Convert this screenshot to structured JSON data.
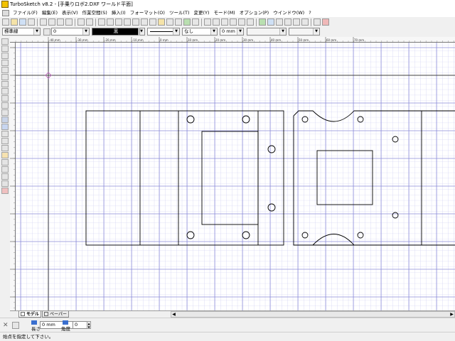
{
  "window": {
    "title": "TurboSketch v8.2 - [手乗りロボ2.DXF ワールド平面]"
  },
  "menu": {
    "items": [
      "ファイル(F)",
      "編集(E)",
      "表示(V)",
      "作業空間(S)",
      "挿入(I)",
      "フォーマット(O)",
      "ツール(T)",
      "変更(Y)",
      "モード(M)",
      "オプション(P)",
      "ウインドウ(W)",
      "?"
    ]
  },
  "properties": {
    "layer": "標準線",
    "linetype_value": "0",
    "color": "黒",
    "fill": "なし",
    "width": "0 mm"
  },
  "rulers": {
    "top_labels": [
      "-40 mm",
      "-30 mm",
      "-20 mm",
      "-10 mm",
      "0 mm",
      "10 mm",
      "20 mm",
      "30 mm",
      "40 mm",
      "50 mm",
      "60 mm",
      "70 mm"
    ]
  },
  "tabs": {
    "model": "モデル",
    "paper": "ペーパー"
  },
  "input_bar": {
    "length_label": "長さ",
    "length_value": "0 mm",
    "angle_label": "角度",
    "angle_value": "0"
  },
  "status": {
    "message": "始点を指定して下さい。"
  },
  "colors": {
    "grid": "#c8c8f0",
    "grid_major": "#8c8cd8",
    "drawing": "#000000",
    "crosshair": "#404040"
  }
}
